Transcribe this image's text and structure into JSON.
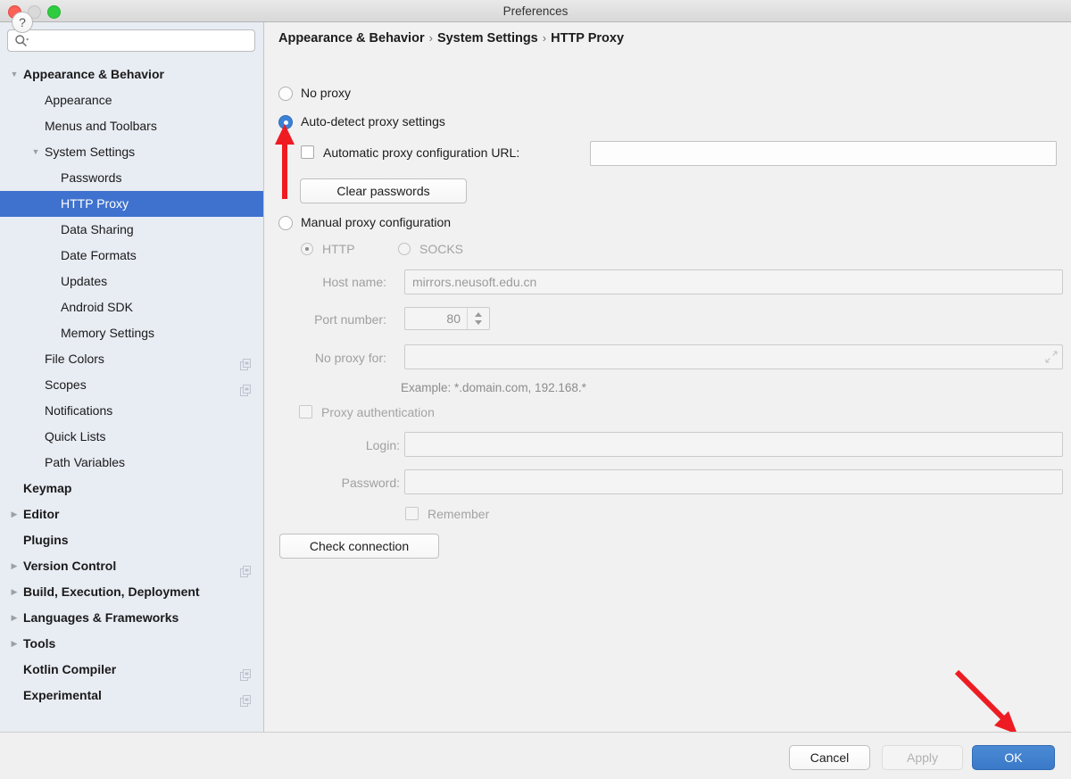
{
  "window": {
    "title": "Preferences",
    "traffic_lights": [
      "close-red",
      "minimize-gray",
      "maximize-green"
    ]
  },
  "search": {
    "value": "",
    "placeholder": "",
    "icon": "search-icon"
  },
  "sidebar": {
    "items": [
      {
        "label": "Appearance & Behavior",
        "indent": 26,
        "bold": true,
        "twisty": "down",
        "selected": false,
        "icon": null
      },
      {
        "label": "Appearance",
        "indent": 50,
        "bold": false,
        "twisty": null,
        "selected": false,
        "icon": null
      },
      {
        "label": "Menus and Toolbars",
        "indent": 50,
        "bold": false,
        "twisty": null,
        "selected": false,
        "icon": null
      },
      {
        "label": "System Settings",
        "indent": 50,
        "bold": false,
        "twisty": "down",
        "selected": false,
        "icon": null
      },
      {
        "label": "Passwords",
        "indent": 68,
        "bold": false,
        "twisty": null,
        "selected": false,
        "icon": null
      },
      {
        "label": "HTTP Proxy",
        "indent": 68,
        "bold": false,
        "twisty": null,
        "selected": true,
        "icon": null
      },
      {
        "label": "Data Sharing",
        "indent": 68,
        "bold": false,
        "twisty": null,
        "selected": false,
        "icon": null
      },
      {
        "label": "Date Formats",
        "indent": 68,
        "bold": false,
        "twisty": null,
        "selected": false,
        "icon": null
      },
      {
        "label": "Updates",
        "indent": 68,
        "bold": false,
        "twisty": null,
        "selected": false,
        "icon": null
      },
      {
        "label": "Android SDK",
        "indent": 68,
        "bold": false,
        "twisty": null,
        "selected": false,
        "icon": null
      },
      {
        "label": "Memory Settings",
        "indent": 68,
        "bold": false,
        "twisty": null,
        "selected": false,
        "icon": null
      },
      {
        "label": "File Colors",
        "indent": 50,
        "bold": false,
        "twisty": null,
        "selected": false,
        "icon": "project-scope-icon"
      },
      {
        "label": "Scopes",
        "indent": 50,
        "bold": false,
        "twisty": null,
        "selected": false,
        "icon": "project-scope-icon"
      },
      {
        "label": "Notifications",
        "indent": 50,
        "bold": false,
        "twisty": null,
        "selected": false,
        "icon": null
      },
      {
        "label": "Quick Lists",
        "indent": 50,
        "bold": false,
        "twisty": null,
        "selected": false,
        "icon": null
      },
      {
        "label": "Path Variables",
        "indent": 50,
        "bold": false,
        "twisty": null,
        "selected": false,
        "icon": null
      },
      {
        "label": "Keymap",
        "indent": 26,
        "bold": true,
        "twisty": null,
        "selected": false,
        "icon": null
      },
      {
        "label": "Editor",
        "indent": 26,
        "bold": true,
        "twisty": "right",
        "selected": false,
        "icon": null
      },
      {
        "label": "Plugins",
        "indent": 26,
        "bold": true,
        "twisty": null,
        "selected": false,
        "icon": null
      },
      {
        "label": "Version Control",
        "indent": 26,
        "bold": true,
        "twisty": "right",
        "selected": false,
        "icon": "project-scope-icon"
      },
      {
        "label": "Build, Execution, Deployment",
        "indent": 26,
        "bold": true,
        "twisty": "right",
        "selected": false,
        "icon": null
      },
      {
        "label": "Languages & Frameworks",
        "indent": 26,
        "bold": true,
        "twisty": "right",
        "selected": false,
        "icon": null
      },
      {
        "label": "Tools",
        "indent": 26,
        "bold": true,
        "twisty": "right",
        "selected": false,
        "icon": null
      },
      {
        "label": "Kotlin Compiler",
        "indent": 26,
        "bold": true,
        "twisty": null,
        "selected": false,
        "icon": "project-scope-icon"
      },
      {
        "label": "Experimental",
        "indent": 26,
        "bold": true,
        "twisty": null,
        "selected": false,
        "icon": "project-scope-icon"
      }
    ]
  },
  "main": {
    "breadcrumb": [
      "Appearance & Behavior",
      "System Settings",
      "HTTP Proxy"
    ],
    "breadcrumb_separator": "›",
    "proxy_mode": "auto_detect",
    "options": {
      "no_proxy_label": "No proxy",
      "auto_detect_label": "Auto-detect proxy settings",
      "auto_config_url_label": "Automatic proxy configuration URL:",
      "auto_config_url_value": "",
      "auto_config_url_checked": false,
      "clear_passwords_label": "Clear passwords",
      "manual_label": "Manual proxy configuration",
      "http_label": "HTTP",
      "socks_label": "SOCKS",
      "protocol_selected": "HTTP",
      "host_name_label": "Host name:",
      "host_name_value": "mirrors.neusoft.edu.cn",
      "port_number_label": "Port number:",
      "port_number_value": "80",
      "no_proxy_for_label": "No proxy for:",
      "no_proxy_for_value": "",
      "example_text": "Example: *.domain.com, 192.168.*",
      "proxy_auth_label": "Proxy authentication",
      "proxy_auth_checked": false,
      "login_label": "Login:",
      "login_value": "",
      "password_label": "Password:",
      "password_value": "",
      "remember_label": "Remember",
      "remember_checked": false,
      "check_connection_label": "Check connection"
    }
  },
  "footer": {
    "help_label": "?",
    "cancel_label": "Cancel",
    "apply_label": "Apply",
    "apply_enabled": false,
    "ok_label": "OK"
  },
  "annotations": {
    "arrow_color": "#ee1c22",
    "arrows": [
      {
        "name": "arrow-to-auto-detect",
        "direction": "up"
      },
      {
        "name": "arrow-to-ok-button",
        "direction": "down-right"
      }
    ]
  }
}
